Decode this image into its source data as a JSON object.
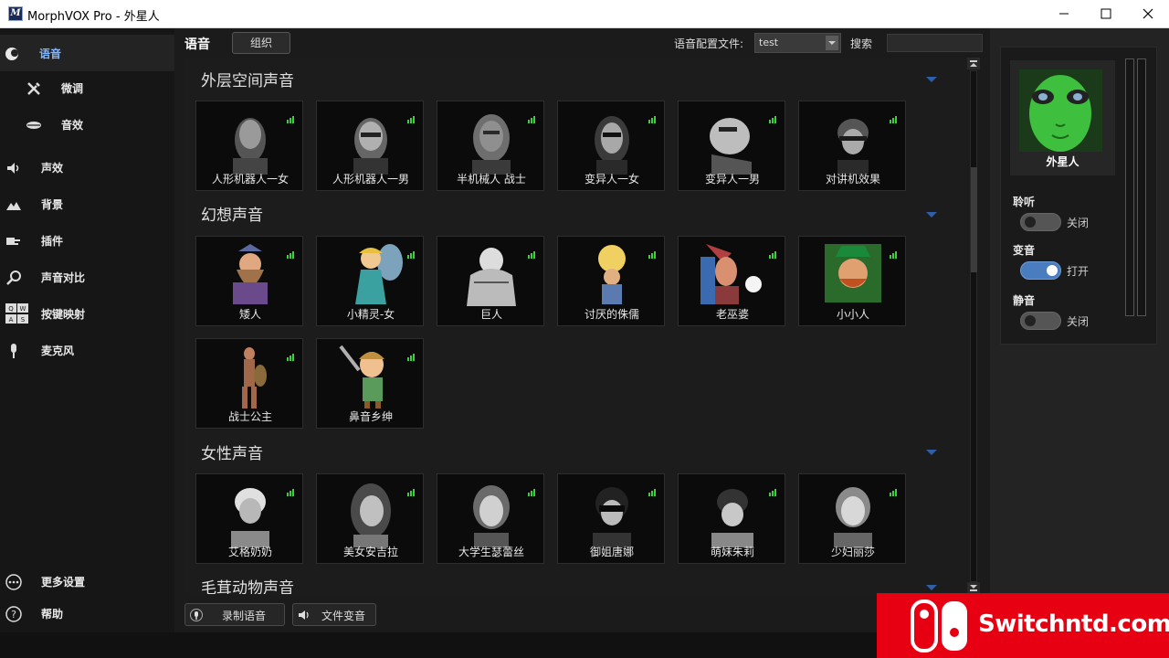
{
  "window": {
    "title": "MorphVOX Pro - 外星人",
    "app_icon": "M"
  },
  "sidebar": {
    "items": [
      {
        "label": "语音",
        "icon": "voice-icon",
        "active": true
      },
      {
        "label": "微调",
        "icon": "tools-icon",
        "sub": true
      },
      {
        "label": "音效",
        "icon": "lips-icon",
        "sub": true
      },
      {
        "label": "声效",
        "icon": "speaker-icon"
      },
      {
        "label": "背景",
        "icon": "landscape-icon"
      },
      {
        "label": "插件",
        "icon": "plugin-icon"
      },
      {
        "label": "声音对比",
        "icon": "magnifier-icon"
      },
      {
        "label": "按键映射",
        "icon": "keyboard-icon"
      },
      {
        "label": "麦克风",
        "icon": "microphone-icon"
      },
      {
        "label": "更多设置",
        "icon": "more-settings-icon"
      },
      {
        "label": "帮助",
        "icon": "help-icon"
      }
    ]
  },
  "header": {
    "title": "语音",
    "org_button": "组织",
    "profile_label": "语音配置文件:",
    "profile_value": "test",
    "search_label": "搜索",
    "search_value": ""
  },
  "sections": [
    {
      "title": "外层空间声音",
      "voices": [
        "人形机器人一女",
        "人形机器人一男",
        "半机械人 战士",
        "变异人一女",
        "变异人一男",
        "对讲机效果"
      ]
    },
    {
      "title": "幻想声音",
      "voices": [
        "矮人",
        "小精灵-女",
        "巨人",
        "讨厌的侏儒",
        "老巫婆",
        "小小人",
        "战士公主",
        "鼻音乡绅"
      ]
    },
    {
      "title": "女性声音",
      "voices": [
        "艾格奶奶",
        "美女安吉拉",
        "大学生瑟蕾丝",
        "御姐唐娜",
        "萌妹朱莉",
        "少妇丽莎"
      ]
    },
    {
      "title": "毛茸动物声音",
      "voices": []
    }
  ],
  "bottom": {
    "record_label": "录制语音",
    "file_label": "文件变音"
  },
  "right_panel": {
    "selected_voice": "外星人",
    "toggles": [
      {
        "label": "聆听",
        "state": "关闭",
        "on": false
      },
      {
        "label": "变音",
        "state": "打开",
        "on": true
      },
      {
        "label": "静音",
        "state": "关闭",
        "on": false
      }
    ]
  },
  "watermark": {
    "text": "Switchntd.com"
  },
  "colors": {
    "accent": "#4a7cc0",
    "active_nav_text": "#7fb6ff",
    "signal_green": "#3ecf3e",
    "watermark_red": "#e60012"
  }
}
